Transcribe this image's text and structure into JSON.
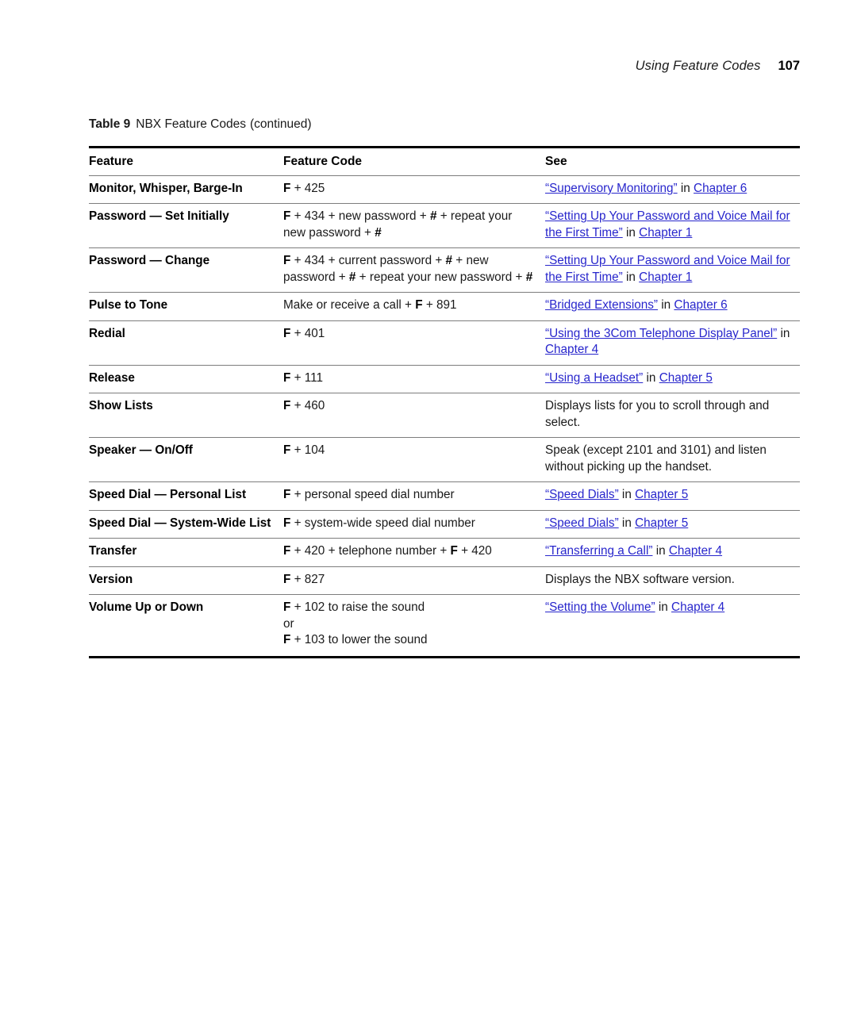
{
  "header": {
    "title": "Using Feature Codes",
    "page_number": "107"
  },
  "caption": {
    "label": "Table 9",
    "text": "NBX Feature Codes",
    "continued": "(continued)"
  },
  "table": {
    "columns": [
      "Feature",
      "Feature Code",
      "See"
    ],
    "rows": [
      {
        "feature": "Monitor, Whisper, Barge-In",
        "code_parts": [
          {
            "t": "F",
            "bold": true
          },
          {
            "t": " + 425",
            "bold": false
          }
        ],
        "see_parts": [
          {
            "t": "“Supervisory Monitoring”",
            "link": true
          },
          {
            "t": " in ",
            "link": false
          },
          {
            "t": "Chapter 6",
            "link": true
          }
        ]
      },
      {
        "feature": "Password — Set Initially",
        "code_parts": [
          {
            "t": "F",
            "bold": true
          },
          {
            "t": " + 434 + new password + ",
            "bold": false
          },
          {
            "t": "#",
            "bold": true
          },
          {
            "t": " + repeat your new password + ",
            "bold": false
          },
          {
            "t": "#",
            "bold": true
          }
        ],
        "see_parts": [
          {
            "t": "“Setting Up Your Password and Voice Mail for the First Time”",
            "link": true
          },
          {
            "t": " in ",
            "link": false
          },
          {
            "t": "Chapter 1",
            "link": true
          }
        ]
      },
      {
        "feature": "Password — Change",
        "code_parts": [
          {
            "t": "F",
            "bold": true
          },
          {
            "t": " + 434 + current password + ",
            "bold": false
          },
          {
            "t": "#",
            "bold": true
          },
          {
            "t": " + new password + ",
            "bold": false
          },
          {
            "t": "#",
            "bold": true
          },
          {
            "t": " + repeat your new password + ",
            "bold": false
          },
          {
            "t": "#",
            "bold": true
          }
        ],
        "see_parts": [
          {
            "t": "“Setting Up Your Password and Voice Mail for the First Time”",
            "link": true
          },
          {
            "t": " in ",
            "link": false
          },
          {
            "t": "Chapter 1",
            "link": true
          }
        ]
      },
      {
        "feature": "Pulse to Tone",
        "code_parts": [
          {
            "t": "Make or receive a call + ",
            "bold": false
          },
          {
            "t": "F",
            "bold": true
          },
          {
            "t": " + 891",
            "bold": false
          }
        ],
        "see_parts": [
          {
            "t": "“Bridged Extensions”",
            "link": true
          },
          {
            "t": " in ",
            "link": false
          },
          {
            "t": "Chapter 6",
            "link": true
          }
        ]
      },
      {
        "feature": "Redial",
        "code_parts": [
          {
            "t": "F",
            "bold": true
          },
          {
            "t": " + 401",
            "bold": false
          }
        ],
        "see_parts": [
          {
            "t": "“Using the 3Com Telephone Display Panel”",
            "link": true
          },
          {
            "t": " in ",
            "link": false
          },
          {
            "t": "Chapter 4",
            "link": true
          }
        ]
      },
      {
        "feature": "Release",
        "code_parts": [
          {
            "t": "F",
            "bold": true
          },
          {
            "t": " + 111",
            "bold": false
          }
        ],
        "see_parts": [
          {
            "t": "“Using a Headset”",
            "link": true
          },
          {
            "t": " in ",
            "link": false
          },
          {
            "t": "Chapter 5",
            "link": true
          }
        ]
      },
      {
        "feature": "Show Lists",
        "code_parts": [
          {
            "t": "F",
            "bold": true
          },
          {
            "t": " + 460",
            "bold": false
          }
        ],
        "see_parts": [
          {
            "t": "Displays lists for you to scroll through and select.",
            "link": false
          }
        ]
      },
      {
        "feature": "Speaker — On/Off",
        "code_parts": [
          {
            "t": "F",
            "bold": true
          },
          {
            "t": " + 104",
            "bold": false
          }
        ],
        "see_parts": [
          {
            "t": "Speak (except 2101 and 3101) and listen without picking up the handset.",
            "link": false
          }
        ]
      },
      {
        "feature": "Speed Dial — Personal List",
        "code_parts": [
          {
            "t": "F",
            "bold": true
          },
          {
            "t": " + personal speed dial number",
            "bold": false
          }
        ],
        "see_parts": [
          {
            "t": "“Speed Dials”",
            "link": true
          },
          {
            "t": " in ",
            "link": false
          },
          {
            "t": "Chapter 5",
            "link": true
          }
        ]
      },
      {
        "feature": "Speed Dial — System-Wide List",
        "code_parts": [
          {
            "t": "F",
            "bold": true
          },
          {
            "t": " + system-wide speed dial number",
            "bold": false
          }
        ],
        "see_parts": [
          {
            "t": "“Speed Dials”",
            "link": true
          },
          {
            "t": " in ",
            "link": false
          },
          {
            "t": "Chapter 5",
            "link": true
          }
        ]
      },
      {
        "feature": "Transfer",
        "code_parts": [
          {
            "t": "F",
            "bold": true
          },
          {
            "t": " + 420 + telephone number + ",
            "bold": false
          },
          {
            "t": "F",
            "bold": true
          },
          {
            "t": " + 420",
            "bold": false
          }
        ],
        "see_parts": [
          {
            "t": "“Transferring a Call”",
            "link": true
          },
          {
            "t": " in ",
            "link": false
          },
          {
            "t": "Chapter 4",
            "link": true
          }
        ]
      },
      {
        "feature": "Version",
        "code_parts": [
          {
            "t": "F",
            "bold": true
          },
          {
            "t": " + 827",
            "bold": false
          }
        ],
        "see_parts": [
          {
            "t": "Displays the NBX software version.",
            "link": false
          }
        ]
      },
      {
        "feature": "Volume Up or Down",
        "code_parts": [
          {
            "t": "F",
            "bold": true
          },
          {
            "t": " + 102 to raise the sound",
            "bold": false
          },
          {
            "t": "\n",
            "bold": false
          },
          {
            "t": "or",
            "bold": false
          },
          {
            "t": "\n",
            "bold": false
          },
          {
            "t": "F",
            "bold": true
          },
          {
            "t": " + 103 to lower the sound",
            "bold": false
          }
        ],
        "see_parts": [
          {
            "t": "“Setting the Volume”",
            "link": true
          },
          {
            "t": " in ",
            "link": false
          },
          {
            "t": "Chapter 4",
            "link": true
          }
        ]
      }
    ]
  },
  "colors": {
    "link": "#2826cc",
    "text": "#1a1a1a",
    "rule_thick": "#000000",
    "rule_thin": "#7d7d7d"
  }
}
